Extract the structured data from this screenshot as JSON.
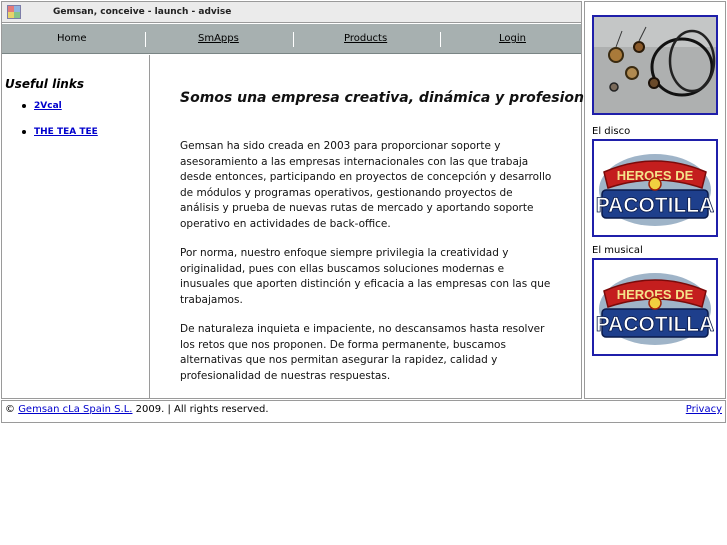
{
  "header": {
    "site_title": "Gemsan, conceive - launch - advise"
  },
  "nav": {
    "items": [
      {
        "label": "Home"
      },
      {
        "label": "SmApps"
      },
      {
        "label": "Products"
      },
      {
        "label": "Login"
      }
    ]
  },
  "sidebar": {
    "title": "Useful links",
    "links": [
      {
        "label": "2Vcal"
      },
      {
        "label": "THE TEA TEE"
      }
    ]
  },
  "main": {
    "heading": "Somos una empresa creativa, dinámica y profesional",
    "paragraphs": [
      "Gemsan ha sido creada en 2003 para proporcionar soporte y asesoramiento a las empresas internacionales con las que trabaja desde entonces, participando en proyectos de concepción y desarrollo de módulos y programas operativos, gestionando proyectos de análisis y prueba de nuevas rutas de mercado y aportando soporte operativo en actividades de back-office.",
      "Por norma, nuestro enfoque siempre privilegia la creatividad y originalidad, pues con ellas buscamos soluciones modernas e inusuales que aporten distinción y eficacia a las empresas con las que trabajamos.",
      "De naturaleza inquieta e impaciente, no descansamos hasta resolver los retos que nos proponen. De forma permanente, buscamos alternativas que nos permitan asegurar la rapidez, calidad y profesionalidad de nuestras respuestas."
    ]
  },
  "right": {
    "caption_disco": "El disco",
    "caption_musical": "El musical",
    "banner_text_top": "HEROES DE",
    "banner_text_bottom": "PACOTILLA"
  },
  "footer": {
    "copy_prefix": "©",
    "company_link": "Gemsan cLa Spain S.L.",
    "copy_suffix": "2009. | All rights reserved.",
    "privacy": "Privacy"
  },
  "colors": {
    "nav_bg": "#a7b0b0",
    "link": "#0000cc",
    "image_border": "#1f1faa"
  }
}
